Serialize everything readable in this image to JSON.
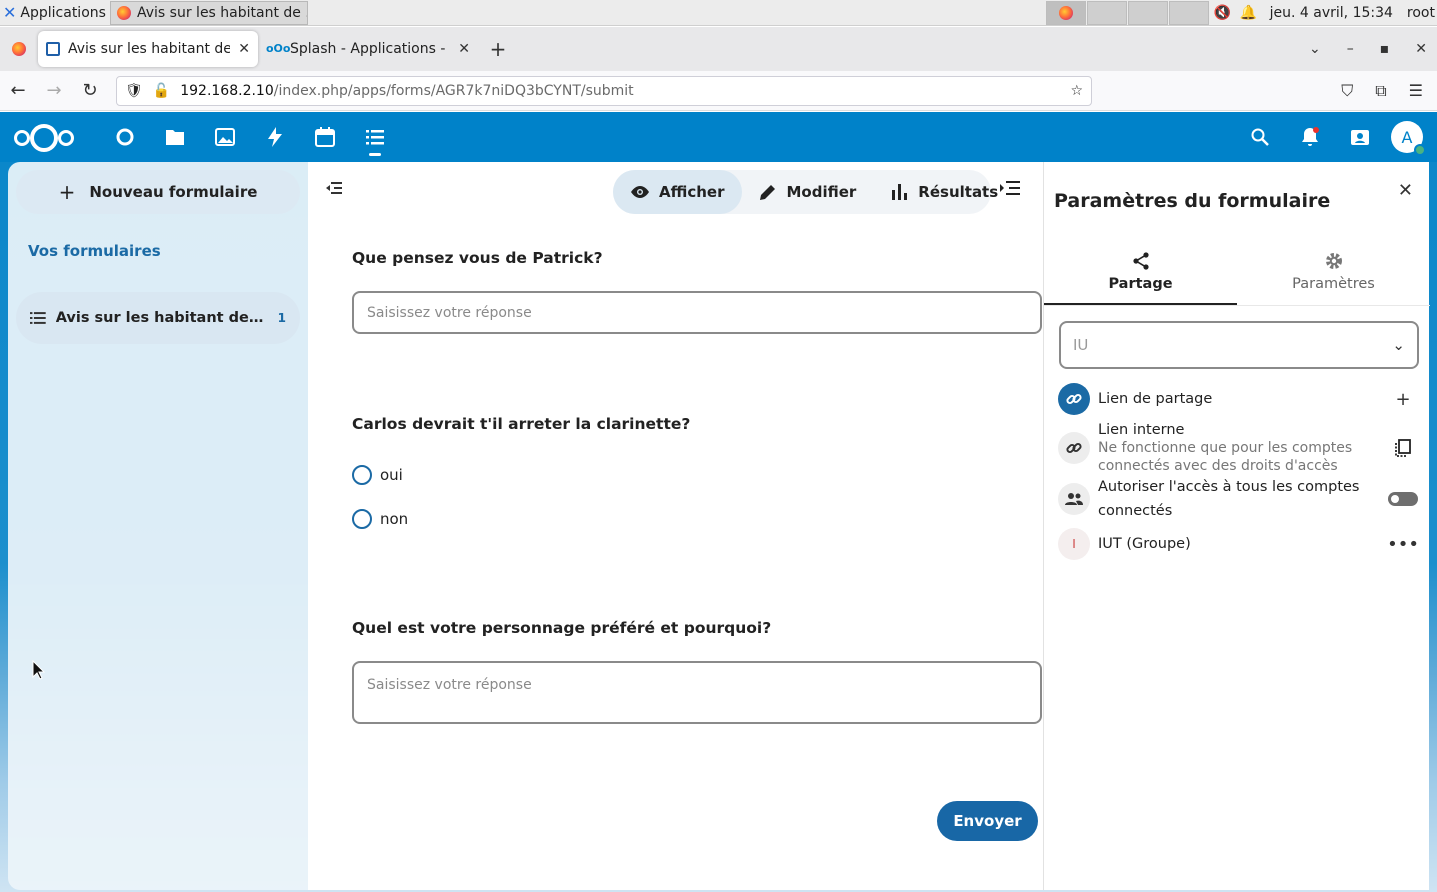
{
  "os": {
    "apps_label": "Applications",
    "task_label": "Avis sur les habitant de ...",
    "clock": "jeu. 4 avril, 15:34",
    "user": "root"
  },
  "browser": {
    "tabs": [
      {
        "label": "Avis sur les habitant de Biki",
        "active": true
      },
      {
        "label": "Splash - Applications - Ap",
        "active": false
      }
    ],
    "url_host": "192.168.2.10",
    "url_path": "/index.php/apps/forms/AGR7k7niDQ3bCYNT/submit"
  },
  "nav": {
    "new_form": "Nouveau formulaire",
    "caption": "Vos formulaires",
    "forms": [
      {
        "label": "Avis sur les habitant de Biki...",
        "count": "1"
      }
    ]
  },
  "viewbar": {
    "view": "Afficher",
    "edit": "Modifier",
    "results": "Résultats"
  },
  "form": {
    "q1": {
      "title": "Que pensez vous de Patrick?",
      "placeholder": "Saisissez votre réponse"
    },
    "q2": {
      "title": "Carlos devrait t'il arreter la clarinette?",
      "options": [
        "oui",
        "non"
      ]
    },
    "q3": {
      "title": "Quel est votre personnage préféré et pourquoi?",
      "placeholder": "Saisissez votre réponse"
    },
    "submit": "Envoyer"
  },
  "sidebar": {
    "title": "Paramètres du formulaire",
    "tab_share": "Partage",
    "tab_settings": "Paramètres",
    "search_value": "IU",
    "share_link": "Lien de partage",
    "internal_link": "Lien interne",
    "internal_link_sub": "Ne fonctionne que pour les comptes connectés avec des droits d'accès",
    "allow_all_1": "Autoriser l'accès à tous les comptes",
    "allow_all_2": "connectés",
    "group": "IUT (Groupe)",
    "group_initial": "I"
  },
  "colors": {
    "nc_blue": "#0082c9",
    "primary": "#1867a6"
  }
}
